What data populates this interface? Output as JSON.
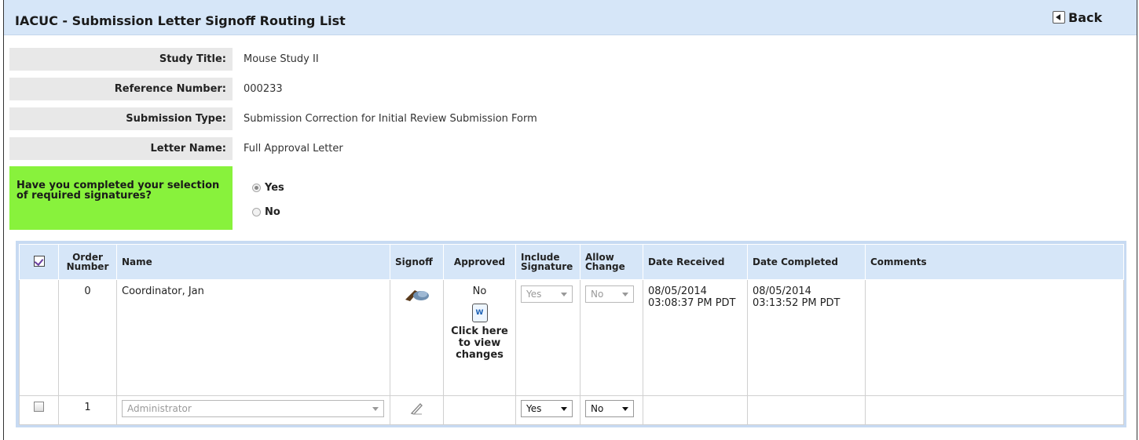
{
  "header": {
    "title": "IACUC - Submission Letter Signoff Routing List",
    "back_label": "Back"
  },
  "info": [
    {
      "label": "Study Title:",
      "value": "Mouse Study II"
    },
    {
      "label": "Reference Number:",
      "value": "000233"
    },
    {
      "label": "Submission Type:",
      "value": "Submission Correction for Initial Review Submission Form"
    },
    {
      "label": "Letter Name:",
      "value": "Full Approval Letter"
    }
  ],
  "question": {
    "text": "Have you completed your selection of required signatures?",
    "options": [
      "Yes",
      "No"
    ],
    "selected": "Yes"
  },
  "grid": {
    "columns": {
      "order": "Order Number",
      "name": "Name",
      "signoff": "Signoff",
      "approved": "Approved",
      "include": "Include Signature",
      "allow": "Allow Change",
      "received": "Date Received",
      "completed": "Date Completed",
      "comments": "Comments"
    },
    "rows": [
      {
        "order": "0",
        "name": "Coordinator, Jan",
        "approved": "No",
        "doc_icon_letter": "W",
        "view_changes_link": "Click here to view changes",
        "include": "Yes",
        "allow": "No",
        "date_received": "08/05/2014 03:08:37 PM PDT",
        "date_completed": "08/05/2014 03:13:52 PM PDT",
        "comments": ""
      },
      {
        "order": "1",
        "name_placeholder": "Administrator",
        "approved": "",
        "include": "Yes",
        "allow": "No",
        "date_received": "",
        "date_completed": "",
        "comments": ""
      }
    ]
  },
  "icons": {
    "back": "back-arrow-icon",
    "signed": "signed-hand-icon",
    "unsigned": "unsigned-pen-icon",
    "doc": "word-document-icon",
    "select_all": "select-all-check-icon"
  },
  "colors": {
    "header_bg": "#d6e6f8",
    "question_bg": "#88f23c",
    "label_bg": "#e8e8e8"
  }
}
